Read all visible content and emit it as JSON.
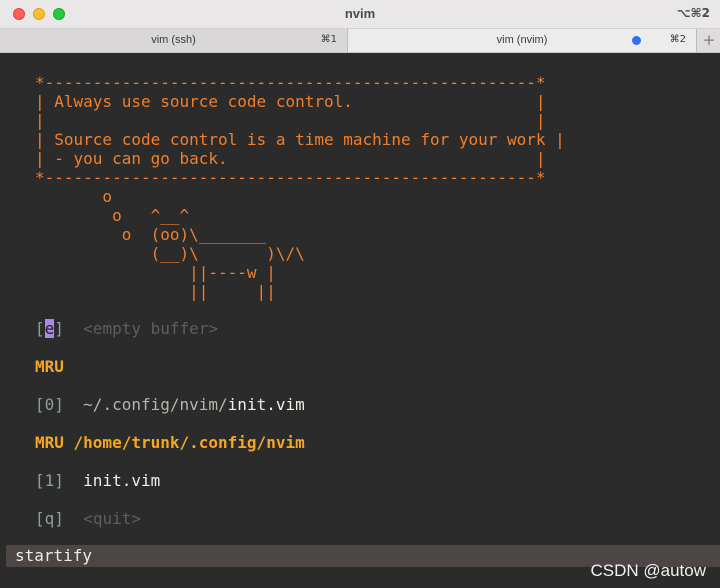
{
  "window": {
    "title": "nvim",
    "shortcut": "⌥⌘2"
  },
  "tabs": [
    {
      "label": "vim (ssh)",
      "shortcut": "⌘1"
    },
    {
      "label": "vim (nvim)",
      "shortcut": "⌘2"
    }
  ],
  "tab_add_label": "+",
  "header": {
    "cowsay": "*---------------------------------------------------*\n| Always use source code control.                   |\n|                                                   |\n| Source code control is a time machine for your work |\n| - you can go back.                                |\n*---------------------------------------------------*\n       o\n        o   ^__^\n         o  (oo)\\_______\n            (__)\\       )\\/\\\n                ||----w |\n                ||     ||"
  },
  "entries": {
    "empty": {
      "open": "[",
      "key": "e",
      "close": "]",
      "label": "<empty buffer>"
    },
    "mru_title": "MRU",
    "mru_item": {
      "index": "[0]",
      "path": "~/.config/nvim/",
      "file": "init.vim"
    },
    "mru_dir_title": "MRU /home/trunk/.config/nvim",
    "mru_dir_item": {
      "index": "[1]",
      "file": "init.vim"
    },
    "quit": {
      "open": "[",
      "key": "q",
      "close": "]",
      "label": "<quit>"
    }
  },
  "statusline": "startify",
  "watermark": "CSDN @autow",
  "colors": {
    "orange": "#f37f2a",
    "mru_header": "#f5a623",
    "cursor": "#a889e8",
    "background": "#2b2b2b"
  }
}
